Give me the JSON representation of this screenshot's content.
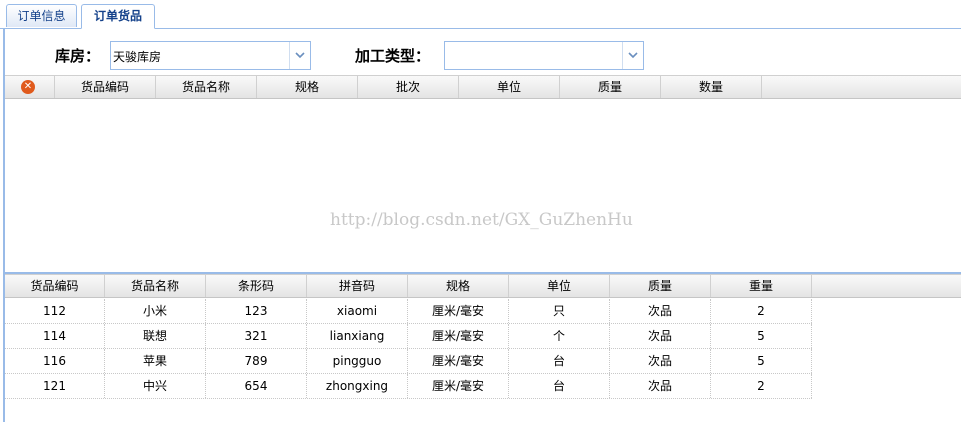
{
  "tabs": [
    {
      "label": "订单信息"
    },
    {
      "label": "订单货品"
    }
  ],
  "filters": {
    "warehouse_label": "库房：",
    "warehouse_value": "天骏库房",
    "process_label": "加工类型：",
    "process_value": ""
  },
  "top_grid": {
    "columns": [
      "货品编码",
      "货品名称",
      "规格",
      "批次",
      "单位",
      "质量",
      "数量"
    ]
  },
  "watermark": "http://blog.csdn.net/GX_GuZhenHu",
  "bottom_grid": {
    "columns": [
      "货品编码",
      "货品名称",
      "条形码",
      "拼音码",
      "规格",
      "单位",
      "质量",
      "重量"
    ],
    "rows": [
      [
        "112",
        "小米",
        "123",
        "xiaomi",
        "厘米/毫安",
        "只",
        "次品",
        "2"
      ],
      [
        "114",
        "联想",
        "321",
        "lianxiang",
        "厘米/毫安",
        "个",
        "次品",
        "5"
      ],
      [
        "116",
        "苹果",
        "789",
        "pingguo",
        "厘米/毫安",
        "台",
        "次品",
        "5"
      ],
      [
        "121",
        "中兴",
        "654",
        "zhongxing",
        "厘米/毫安",
        "台",
        "次品",
        "2"
      ]
    ]
  },
  "icons": {
    "delete": "delete-icon",
    "dropdown": "chevron-down-icon"
  },
  "colors": {
    "border": "#99bbe8",
    "tab_text": "#15428b",
    "delete": "#e05a1c"
  }
}
